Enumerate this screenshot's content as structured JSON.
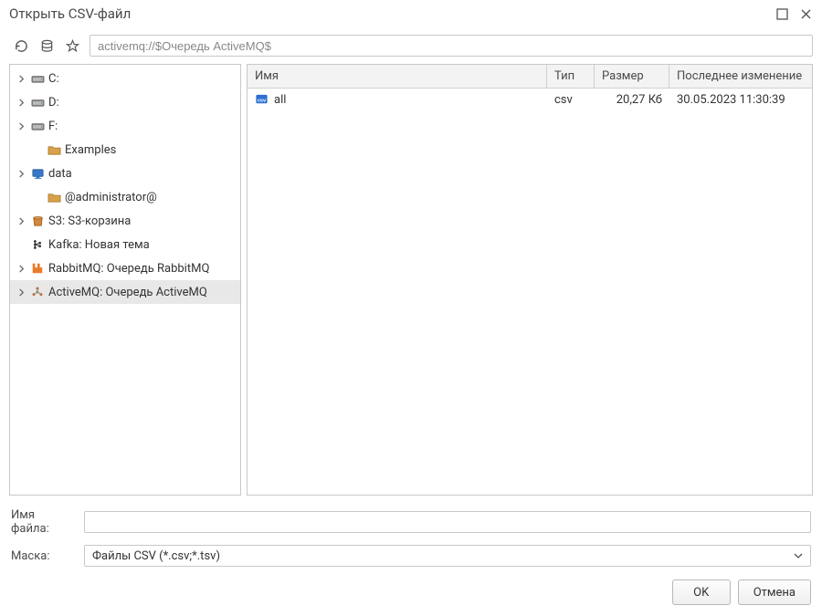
{
  "window": {
    "title": "Открыть CSV-файл"
  },
  "toolbar": {
    "path_value": "activemq://$Очередь ActiveMQ$"
  },
  "tree": {
    "items": [
      {
        "label": "C:",
        "icon": "drive",
        "caret": true,
        "indent": 0
      },
      {
        "label": "D:",
        "icon": "drive",
        "caret": true,
        "indent": 0
      },
      {
        "label": "F:",
        "icon": "drive",
        "caret": true,
        "indent": 0
      },
      {
        "label": "Examples",
        "icon": "folder",
        "caret": false,
        "indent": 1
      },
      {
        "label": "data",
        "icon": "host",
        "caret": true,
        "indent": 0
      },
      {
        "label": "@administrator@",
        "icon": "folder",
        "caret": false,
        "indent": 1
      },
      {
        "label": "S3: S3-корзина",
        "icon": "s3",
        "caret": true,
        "indent": 0
      },
      {
        "label": "Kafka: Новая тема",
        "icon": "kafka",
        "caret": false,
        "indent": 0
      },
      {
        "label": "RabbitMQ: Очередь RabbitMQ",
        "icon": "rabbitmq",
        "caret": true,
        "indent": 0
      },
      {
        "label": "ActiveMQ: Очередь ActiveMQ",
        "icon": "activemq",
        "caret": true,
        "indent": 0,
        "selected": true
      }
    ]
  },
  "table": {
    "headers": {
      "name": "Имя",
      "type": "Тип",
      "size": "Размер",
      "modified": "Последнее изменение"
    },
    "rows": [
      {
        "name": "all",
        "type": "csv",
        "size": "20,27 Кб",
        "modified": "30.05.2023 11:30:39"
      }
    ]
  },
  "form": {
    "filename_label": "Имя файла:",
    "filename_value": "",
    "mask_label": "Маска:",
    "mask_value": "Файлы CSV (*.csv;*.tsv)"
  },
  "buttons": {
    "ok": "OK",
    "cancel": "Отмена"
  }
}
